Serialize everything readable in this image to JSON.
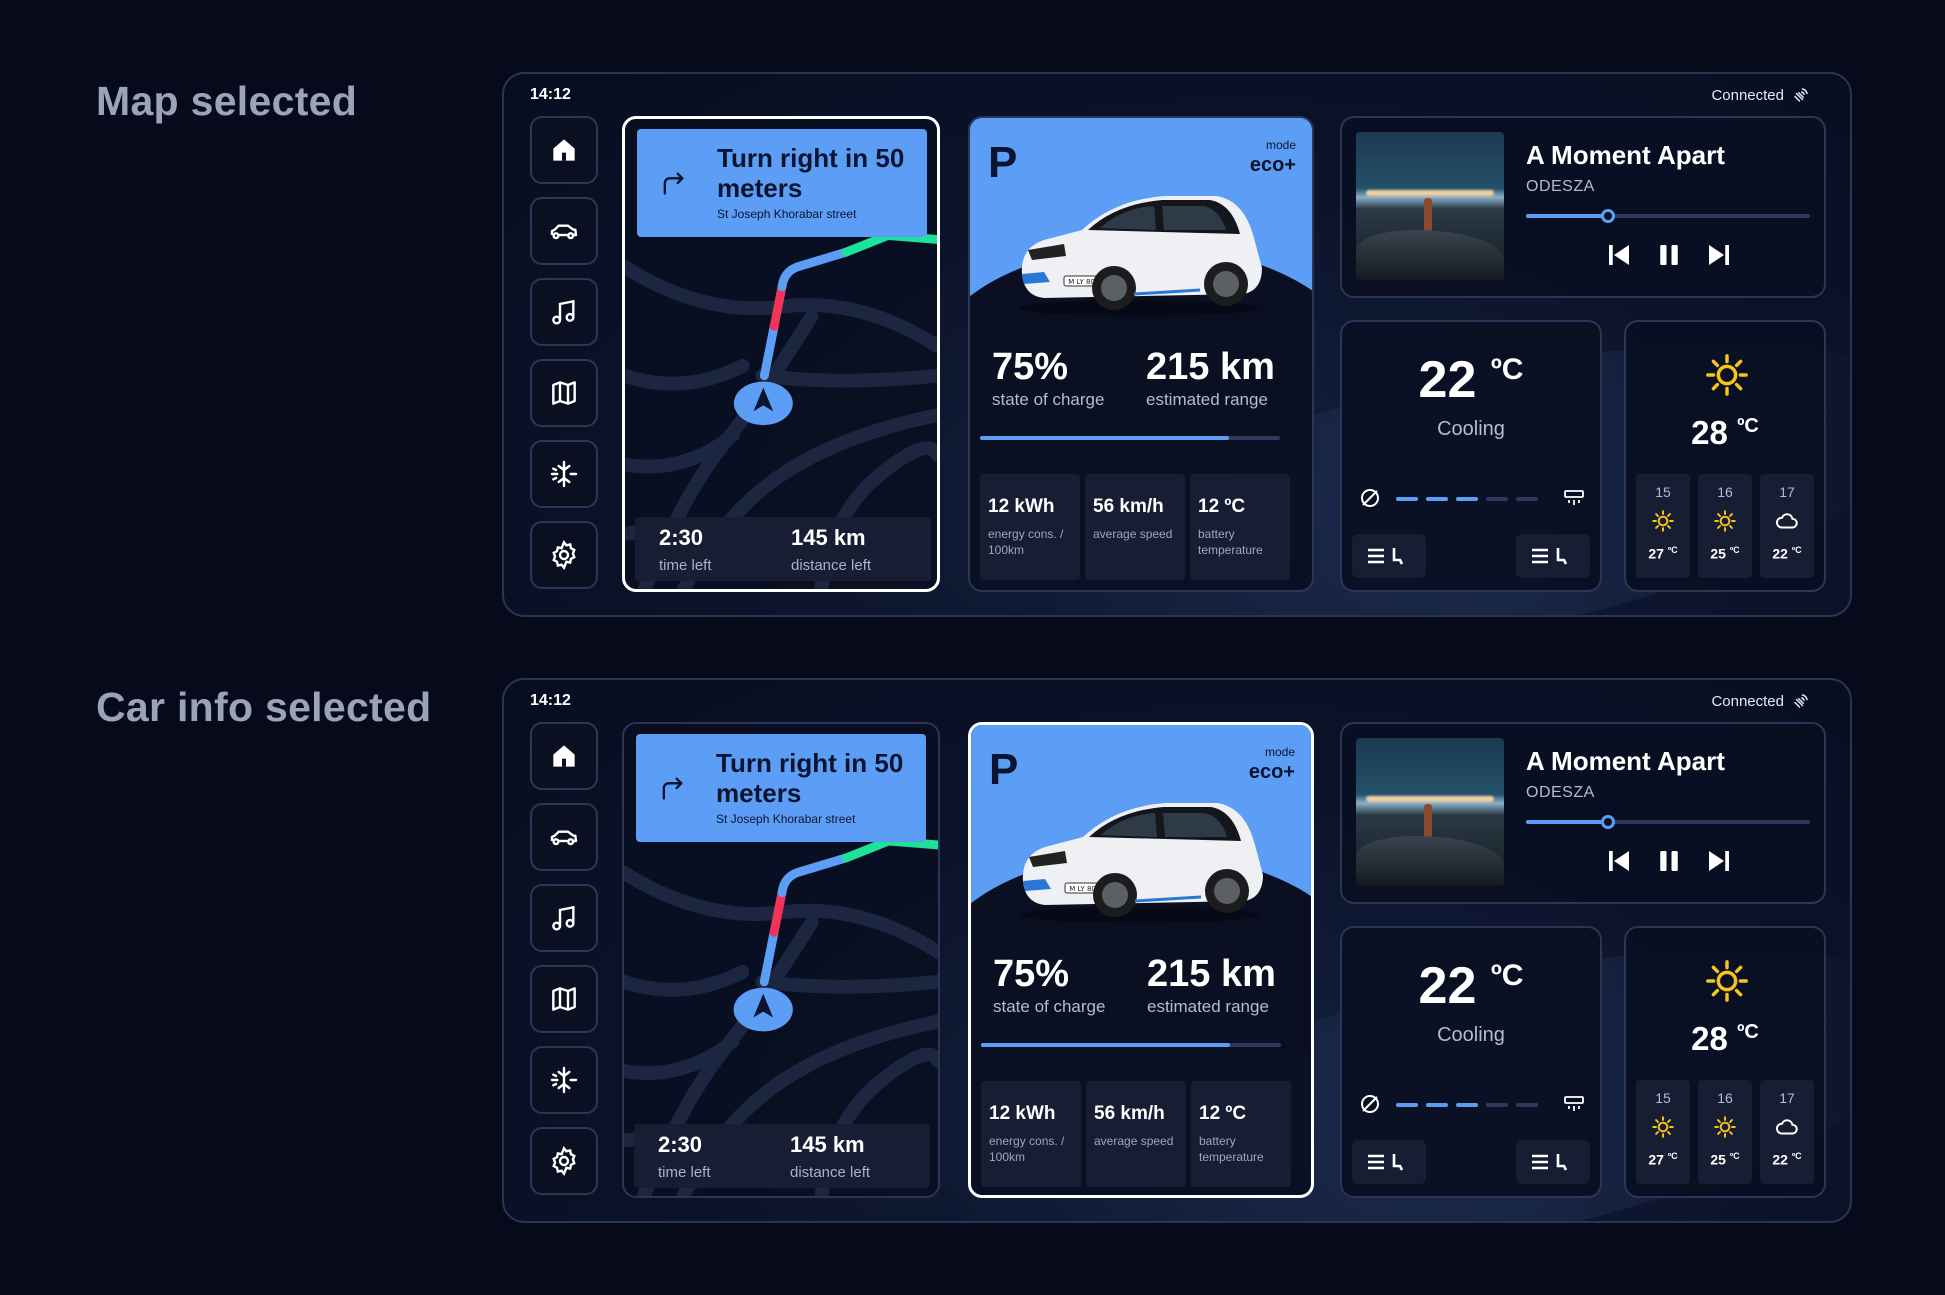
{
  "sections": [
    {
      "heading": "Map selected"
    },
    {
      "heading": "Car info selected"
    }
  ],
  "status": {
    "time": "14:12",
    "connection": "Connected"
  },
  "nav_icons": [
    "home-icon",
    "car-icon",
    "music-icon",
    "map-icon",
    "climate-icon",
    "settings-icon"
  ],
  "navigation": {
    "instruction": "Turn right in 50 meters",
    "street": "St Joseph Khorabar street",
    "time_left": "2:30",
    "time_left_label": "time left",
    "distance_left": "145 km",
    "distance_left_label": "distance left"
  },
  "car": {
    "gear": "P",
    "mode_label": "mode",
    "mode": "eco+",
    "charge": "75%",
    "charge_label": "state of charge",
    "range": "215 km",
    "range_label": "estimated range",
    "charge_fraction": 0.83,
    "plate": "M LY 8002",
    "stats": [
      {
        "value": "12 kWh",
        "label": "energy cons. / 100km"
      },
      {
        "value": "56 km/h",
        "label": "average speed"
      },
      {
        "value": "12 ºC",
        "label": "battery temperature"
      }
    ]
  },
  "music": {
    "title": "A Moment Apart",
    "artist": "ODESZA",
    "progress": 0.29
  },
  "climate": {
    "temperature": "22",
    "unit": "ºC",
    "status": "Cooling",
    "fan_level": 3,
    "fan_max": 5
  },
  "weather": {
    "temperature": "28",
    "unit": "ºC",
    "forecast": [
      {
        "day": "15",
        "icon": "sun-icon",
        "temp": "27",
        "unit": "ºC"
      },
      {
        "day": "16",
        "icon": "sun-icon",
        "temp": "25",
        "unit": "ºC"
      },
      {
        "day": "17",
        "icon": "cloud-icon",
        "temp": "22",
        "unit": "ºC"
      }
    ]
  },
  "colors": {
    "accent": "#5c9ef5",
    "route_blue": "#5c9ef5",
    "route_red": "#f0345a",
    "route_green": "#1fe29a",
    "sun": "#f5c518",
    "background": "#070a1a"
  }
}
